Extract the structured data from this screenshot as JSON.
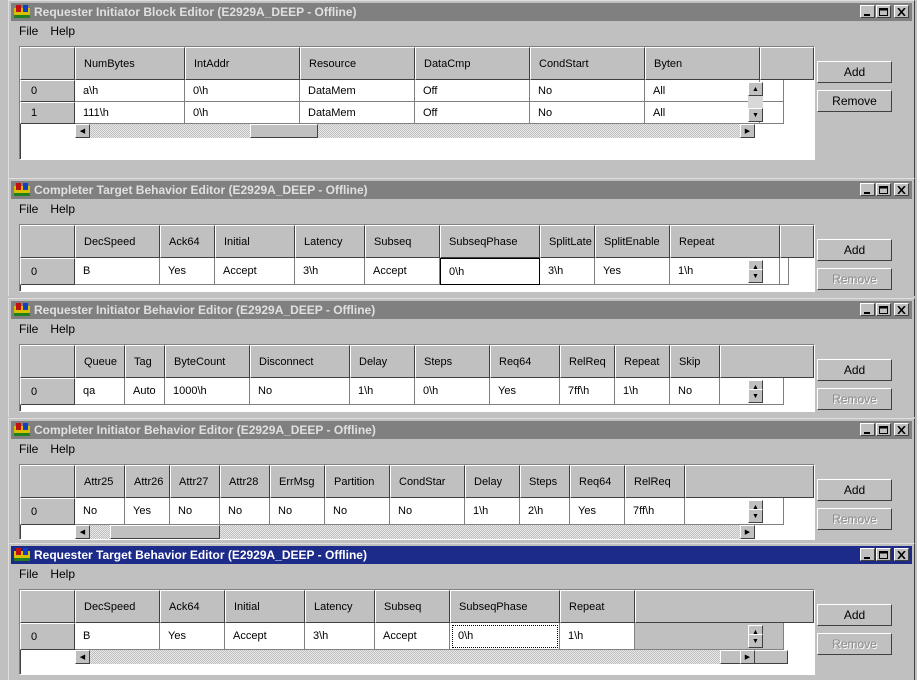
{
  "windows": [
    {
      "title": "Requester Initiator Block Editor (E2929A_DEEP - Offline)",
      "menu": [
        "File",
        "Help"
      ],
      "headers": [
        "NumBytes",
        "IntAddr",
        "Resource",
        "DataCmp",
        "CondStart",
        "Byten"
      ],
      "rows": [
        {
          "index": "0",
          "cells": [
            "a\\h",
            "0\\h",
            "DataMem",
            "Off",
            "No",
            "All"
          ]
        },
        {
          "index": "1",
          "cells": [
            "111\\h",
            "0\\h",
            "DataMem",
            "Off",
            "No",
            "All"
          ]
        }
      ],
      "add_label": "Add",
      "remove_label": "Remove",
      "remove_enabled": true
    },
    {
      "title": "Completer Target Behavior Editor (E2929A_DEEP - Offline)",
      "menu": [
        "File",
        "Help"
      ],
      "headers": [
        "DecSpeed",
        "Ack64",
        "Initial",
        "Latency",
        "Subseq",
        "SubseqPhase",
        "SplitLate",
        "SplitEnable",
        "Repeat"
      ],
      "rows": [
        {
          "index": "0",
          "cells": [
            "B",
            "Yes",
            "Accept",
            "3\\h",
            "Accept",
            "0\\h",
            "3\\h",
            "Yes",
            "1\\h"
          ]
        }
      ],
      "add_label": "Add",
      "remove_label": "Remove",
      "remove_enabled": false
    },
    {
      "title": "Requester Initiator Behavior Editor (E2929A_DEEP - Offline)",
      "menu": [
        "File",
        "Help"
      ],
      "headers": [
        "Queue",
        "Tag",
        "ByteCount",
        "Disconnect",
        "Delay",
        "Steps",
        "Req64",
        "RelReq",
        "Repeat",
        "Skip"
      ],
      "rows": [
        {
          "index": "0",
          "cells": [
            "qa",
            "Auto",
            "1000\\h",
            "No",
            "1\\h",
            "0\\h",
            "Yes",
            "7ff\\h",
            "1\\h",
            "No"
          ]
        }
      ],
      "add_label": "Add",
      "remove_label": "Remove",
      "remove_enabled": false
    },
    {
      "title": "Completer Initiator Behavior Editor (E2929A_DEEP - Offline)",
      "menu": [
        "File",
        "Help"
      ],
      "headers": [
        "Attr25",
        "Attr26",
        "Attr27",
        "Attr28",
        "ErrMsg",
        "Partition",
        "CondStar",
        "Delay",
        "Steps",
        "Req64",
        "RelReq"
      ],
      "rows": [
        {
          "index": "0",
          "cells": [
            "No",
            "Yes",
            "No",
            "No",
            "No",
            "No",
            "No",
            "1\\h",
            "2\\h",
            "Yes",
            "7ff\\h"
          ]
        }
      ],
      "add_label": "Add",
      "remove_label": "Remove",
      "remove_enabled": false
    },
    {
      "title": "Requester Target Behavior Editor (E2929A_DEEP - Offline)",
      "menu": [
        "File",
        "Help"
      ],
      "headers": [
        "DecSpeed",
        "Ack64",
        "Initial",
        "Latency",
        "Subseq",
        "SubseqPhase",
        "Repeat"
      ],
      "rows": [
        {
          "index": "0",
          "cells": [
            "B",
            "Yes",
            "Accept",
            "3\\h",
            "Accept",
            "0\\h",
            "1\\h"
          ]
        }
      ],
      "add_label": "Add",
      "remove_label": "Remove",
      "remove_enabled": false
    }
  ],
  "colors": {
    "active_title": "#1c2a8a",
    "inactive_title": "#808080",
    "face": "#c0c0c0"
  },
  "icons": {
    "window_controls": [
      "minimize-icon",
      "maximize-icon",
      "close-icon"
    ]
  }
}
